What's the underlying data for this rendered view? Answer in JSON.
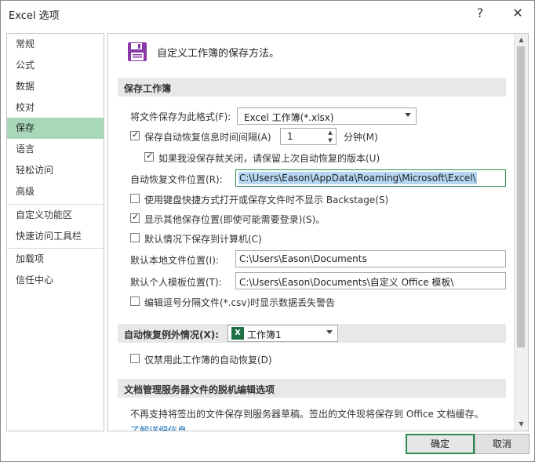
{
  "window": {
    "title": "Excel 选项",
    "help_glyph": "?",
    "close_glyph": "✕"
  },
  "sidebar": {
    "items": [
      {
        "label": "常规"
      },
      {
        "label": "公式"
      },
      {
        "label": "数据"
      },
      {
        "label": "校对"
      },
      {
        "label": "保存"
      },
      {
        "label": "语言"
      },
      {
        "label": "轻松访问"
      },
      {
        "label": "高级"
      },
      {
        "label": "自定义功能区"
      },
      {
        "label": "快速访问工具栏"
      },
      {
        "label": "加载项"
      },
      {
        "label": "信任中心"
      }
    ],
    "selected": "保存"
  },
  "header": {
    "text": "自定义工作簿的保存方法。",
    "icon": "floppy-disk-icon"
  },
  "save_workbooks": {
    "title": "保存工作簿",
    "format_label": "将文件保存为此格式(F):",
    "format_value": "Excel 工作簿(*.xlsx)",
    "autorecover_label": "保存自动恢复信息时间间隔(A)",
    "autorecover_checked": true,
    "autorecover_minutes": "1",
    "minutes_label": "分钟(M)",
    "keep_last_label": "如果我没保存就关闭，请保留上次自动恢复的版本(U)",
    "keep_last_checked": true,
    "autorecover_location_label": "自动恢复文件位置(R):",
    "autorecover_location_value": "C:\\Users\\Eason\\AppData\\Roaming\\Microsoft\\Excel\\",
    "no_backstage_label": "使用键盘快捷方式打开或保存文件时不显示 Backstage(S)",
    "no_backstage_checked": false,
    "show_locations_label": "显示其他保存位置(即使可能需要登录)(S)。",
    "show_locations_checked": true,
    "save_to_computer_label": "默认情况下保存到计算机(C)",
    "save_to_computer_checked": false,
    "default_local_label": "默认本地文件位置(I):",
    "default_local_value": "C:\\Users\\Eason\\Documents",
    "template_location_label": "默认个人模板位置(T):",
    "template_location_value": "C:\\Users\\Eason\\Documents\\自定义 Office 模板\\",
    "csv_warning_label": "编辑逗号分隔文件(*.csv)时显示数据丢失警告",
    "csv_warning_checked": false
  },
  "autorecover_exceptions": {
    "title": "自动恢复例外情况(X):",
    "workbook_value": "工作簿1",
    "disable_label": "仅禁用此工作簿的自动恢复(D)",
    "disable_checked": false
  },
  "offline_editing": {
    "title": "文档管理服务器文件的脱机编辑选项",
    "description": "不再支持将签出的文件保存到服务器草稿。签出的文件现将保存到 Office 文档缓存。",
    "link": "了解详细信息"
  },
  "footer": {
    "ok": "确定",
    "cancel": "取消"
  }
}
